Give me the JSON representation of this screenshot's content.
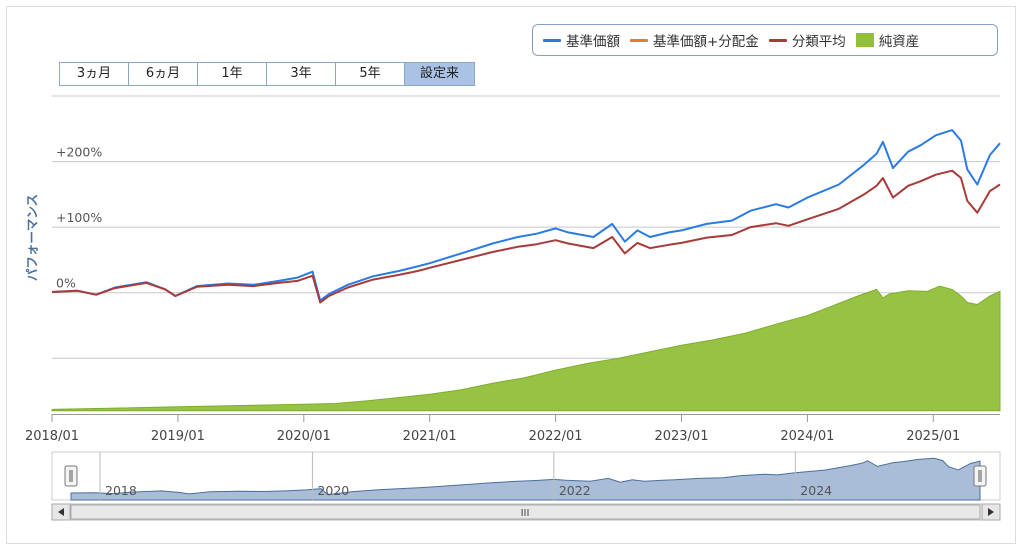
{
  "range_buttons": [
    {
      "label": "3ヵ月",
      "active": false
    },
    {
      "label": "6ヵ月",
      "active": false
    },
    {
      "label": "1年",
      "active": false
    },
    {
      "label": "3年",
      "active": false
    },
    {
      "label": "5年",
      "active": false
    },
    {
      "label": "設定来",
      "active": true
    }
  ],
  "legend": [
    {
      "label": "基準価額",
      "color": "#2a7be4",
      "kind": "line"
    },
    {
      "label": "基準価額+分配金",
      "color": "#f07b1f",
      "kind": "line"
    },
    {
      "label": "分類平均",
      "color": "#a83a3a",
      "kind": "line"
    },
    {
      "label": "純資産",
      "color": "#92bf3a",
      "kind": "area"
    }
  ],
  "navigator": {
    "labels": [
      "2018",
      "2020",
      "2022",
      "2024"
    ],
    "scrollbar_grip": "III"
  },
  "chart_data": {
    "type": "line",
    "ylabel": "パフォーマンス",
    "y_tick_labels": [
      "+200%",
      "+100%",
      "0%"
    ],
    "y_ticks": [
      200,
      100,
      0
    ],
    "ylim": [
      -185,
      300
    ],
    "x_tick_labels": [
      "2018/01",
      "2019/01",
      "2020/01",
      "2021/01",
      "2022/01",
      "2023/01",
      "2024/01",
      "2025/01"
    ],
    "x_ticks": [
      2018.0,
      2019.0,
      2020.0,
      2021.0,
      2022.0,
      2023.0,
      2024.0,
      2025.0
    ],
    "xlim": [
      2018.0,
      2025.53
    ],
    "series": [
      {
        "name": "基準価額",
        "color": "#2a7be4",
        "kind": "line",
        "x": [
          2018.0,
          2018.2,
          2018.35,
          2018.5,
          2018.75,
          2018.9,
          2018.98,
          2019.15,
          2019.4,
          2019.6,
          2019.8,
          2019.95,
          2020.07,
          2020.13,
          2020.2,
          2020.35,
          2020.55,
          2020.75,
          2020.9,
          2021.0,
          2021.25,
          2021.5,
          2021.7,
          2021.85,
          2022.0,
          2022.1,
          2022.3,
          2022.45,
          2022.55,
          2022.65,
          2022.75,
          2022.9,
          2023.0,
          2023.2,
          2023.4,
          2023.55,
          2023.75,
          2023.85,
          2024.0,
          2024.25,
          2024.45,
          2024.55,
          2024.6,
          2024.68,
          2024.8,
          2024.9,
          2025.02,
          2025.15,
          2025.22,
          2025.27,
          2025.35,
          2025.45,
          2025.53
        ],
        "y": [
          1,
          3,
          -3,
          8,
          16,
          5,
          -5,
          10,
          14,
          12,
          18,
          23,
          32,
          -12,
          -2,
          12,
          25,
          33,
          40,
          45,
          60,
          75,
          85,
          90,
          98,
          92,
          85,
          105,
          78,
          95,
          85,
          92,
          95,
          105,
          110,
          125,
          135,
          130,
          145,
          165,
          195,
          212,
          230,
          190,
          215,
          225,
          240,
          248,
          232,
          188,
          165,
          210,
          228
        ]
      },
      {
        "name": "分類平均",
        "color": "#a83a3a",
        "kind": "line",
        "x": [
          2018.0,
          2018.2,
          2018.35,
          2018.5,
          2018.75,
          2018.9,
          2018.98,
          2019.15,
          2019.4,
          2019.6,
          2019.8,
          2019.95,
          2020.07,
          2020.13,
          2020.2,
          2020.35,
          2020.55,
          2020.75,
          2020.9,
          2021.0,
          2021.25,
          2021.5,
          2021.7,
          2021.85,
          2022.0,
          2022.1,
          2022.3,
          2022.45,
          2022.55,
          2022.65,
          2022.75,
          2022.9,
          2023.0,
          2023.2,
          2023.4,
          2023.55,
          2023.75,
          2023.85,
          2024.0,
          2024.25,
          2024.45,
          2024.55,
          2024.6,
          2024.68,
          2024.8,
          2024.9,
          2025.02,
          2025.15,
          2025.22,
          2025.27,
          2025.35,
          2025.45,
          2025.53
        ],
        "y": [
          1,
          3,
          -3,
          7,
          15,
          5,
          -5,
          9,
          12,
          10,
          15,
          18,
          26,
          -15,
          -5,
          8,
          20,
          27,
          33,
          38,
          50,
          62,
          70,
          74,
          80,
          75,
          68,
          85,
          60,
          76,
          68,
          73,
          76,
          84,
          88,
          100,
          106,
          102,
          112,
          128,
          150,
          163,
          175,
          145,
          163,
          170,
          180,
          186,
          175,
          140,
          122,
          155,
          165
        ]
      },
      {
        "name": "純資産",
        "color": "#92bf3a",
        "kind": "area",
        "baseline": -180,
        "x": [
          2018.0,
          2018.5,
          2019.0,
          2019.5,
          2020.0,
          2020.25,
          2020.5,
          2020.75,
          2021.0,
          2021.25,
          2021.5,
          2021.75,
          2022.0,
          2022.25,
          2022.5,
          2022.75,
          2023.0,
          2023.25,
          2023.5,
          2023.75,
          2024.0,
          2024.2,
          2024.4,
          2024.55,
          2024.6,
          2024.65,
          2024.8,
          2024.95,
          2025.05,
          2025.15,
          2025.22,
          2025.27,
          2025.35,
          2025.45,
          2025.53
        ],
        "y": [
          -178,
          -176,
          -174,
          -172,
          -170,
          -169,
          -165,
          -160,
          -155,
          -148,
          -138,
          -130,
          -118,
          -108,
          -100,
          -90,
          -80,
          -72,
          -62,
          -48,
          -35,
          -20,
          -5,
          5,
          -8,
          -2,
          3,
          2,
          10,
          5,
          -5,
          -15,
          -18,
          -5,
          2
        ]
      }
    ]
  }
}
